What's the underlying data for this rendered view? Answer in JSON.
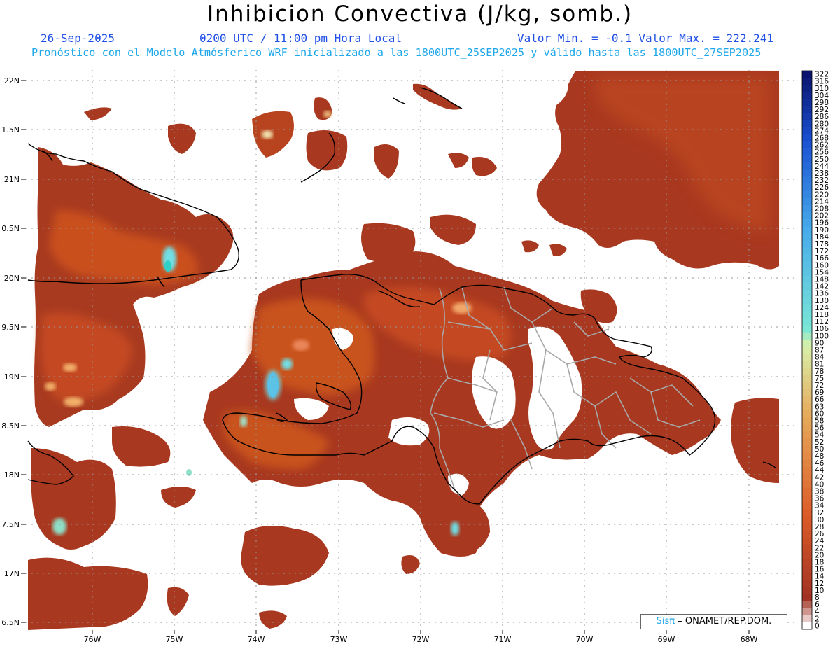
{
  "header": {
    "title": "Inhibicion Convectiva (J/kg, somb.)",
    "date": "26-Sep-2025",
    "time": "0200 UTC / 11:00 pm Hora Local",
    "minmax": "Valor Min. = -0.1  Valor Max. = 222.241",
    "model_line": "Pronóstico con el Modelo Atmósferico WRF inicializado a las 1800UTC_25SEP2025 y válido hasta las  1800UTC_27SEP2025"
  },
  "axes": {
    "lat_labels": [
      "22N",
      "1.5N",
      "21N",
      "0.5N",
      "20N",
      "9.5N",
      "19N",
      "8.5N",
      "18N",
      "7.5N",
      "17N",
      "6.5N"
    ],
    "lon_labels": [
      "76W",
      "75W",
      "74W",
      "73W",
      "72W",
      "71W",
      "70W",
      "69W",
      "68W"
    ]
  },
  "colorbar": {
    "labels": [
      "322",
      "316",
      "310",
      "304",
      "298",
      "292",
      "286",
      "280",
      "274",
      "268",
      "262",
      "256",
      "250",
      "244",
      "238",
      "232",
      "226",
      "220",
      "214",
      "208",
      "202",
      "196",
      "190",
      "184",
      "178",
      "172",
      "166",
      "160",
      "154",
      "148",
      "142",
      "136",
      "130",
      "124",
      "118",
      "112",
      "106",
      "100",
      "90",
      "87",
      "84",
      "81",
      "78",
      "75",
      "72",
      "69",
      "66",
      "63",
      "60",
      "58",
      "56",
      "54",
      "52",
      "50",
      "48",
      "46",
      "44",
      "42",
      "40",
      "38",
      "36",
      "34",
      "32",
      "30",
      "28",
      "26",
      "24",
      "22",
      "20",
      "18",
      "16",
      "14",
      "12",
      "10",
      "8",
      "6",
      "4",
      "2",
      "0"
    ]
  },
  "credit": {
    "sis": "Sisπ",
    "org": "– ONAMET/REP.DOM."
  },
  "colors": {
    "fill_main": "#a8321e",
    "fill_warm": "#cf5524",
    "fill_orange": "#e4702c",
    "fill_light": "#f2a86a",
    "fill_cyan": "#6fe0e6",
    "fill_blue": "#2e7ce6",
    "coast": "#000000",
    "borders": "#a8a8a8",
    "grid": "#999999"
  }
}
